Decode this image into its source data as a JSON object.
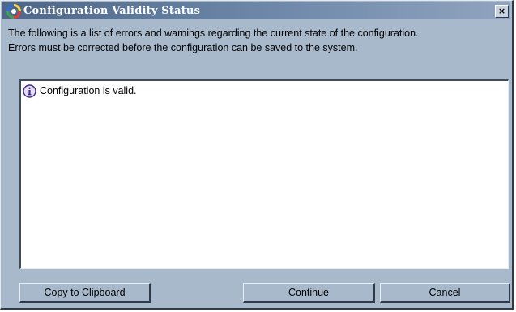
{
  "window": {
    "title": "Configuration Validity Status",
    "close_label": "×"
  },
  "message": {
    "line1": "The following is a list of errors and warnings regarding the current state of the configuration.",
    "line2": "Errors must be corrected before the configuration can be saved to the system."
  },
  "list": {
    "items": [
      {
        "icon": "info-icon",
        "text": "Configuration is valid."
      }
    ]
  },
  "buttons": {
    "copy_label": "Copy to Clipboard",
    "continue_label": "Continue",
    "cancel_label": "Cancel"
  },
  "colors": {
    "dialog_bg": "#a9b9cc",
    "titlebar_start": "#4e6788",
    "titlebar_end": "#8fa4bf",
    "list_bg": "#ffffff"
  }
}
